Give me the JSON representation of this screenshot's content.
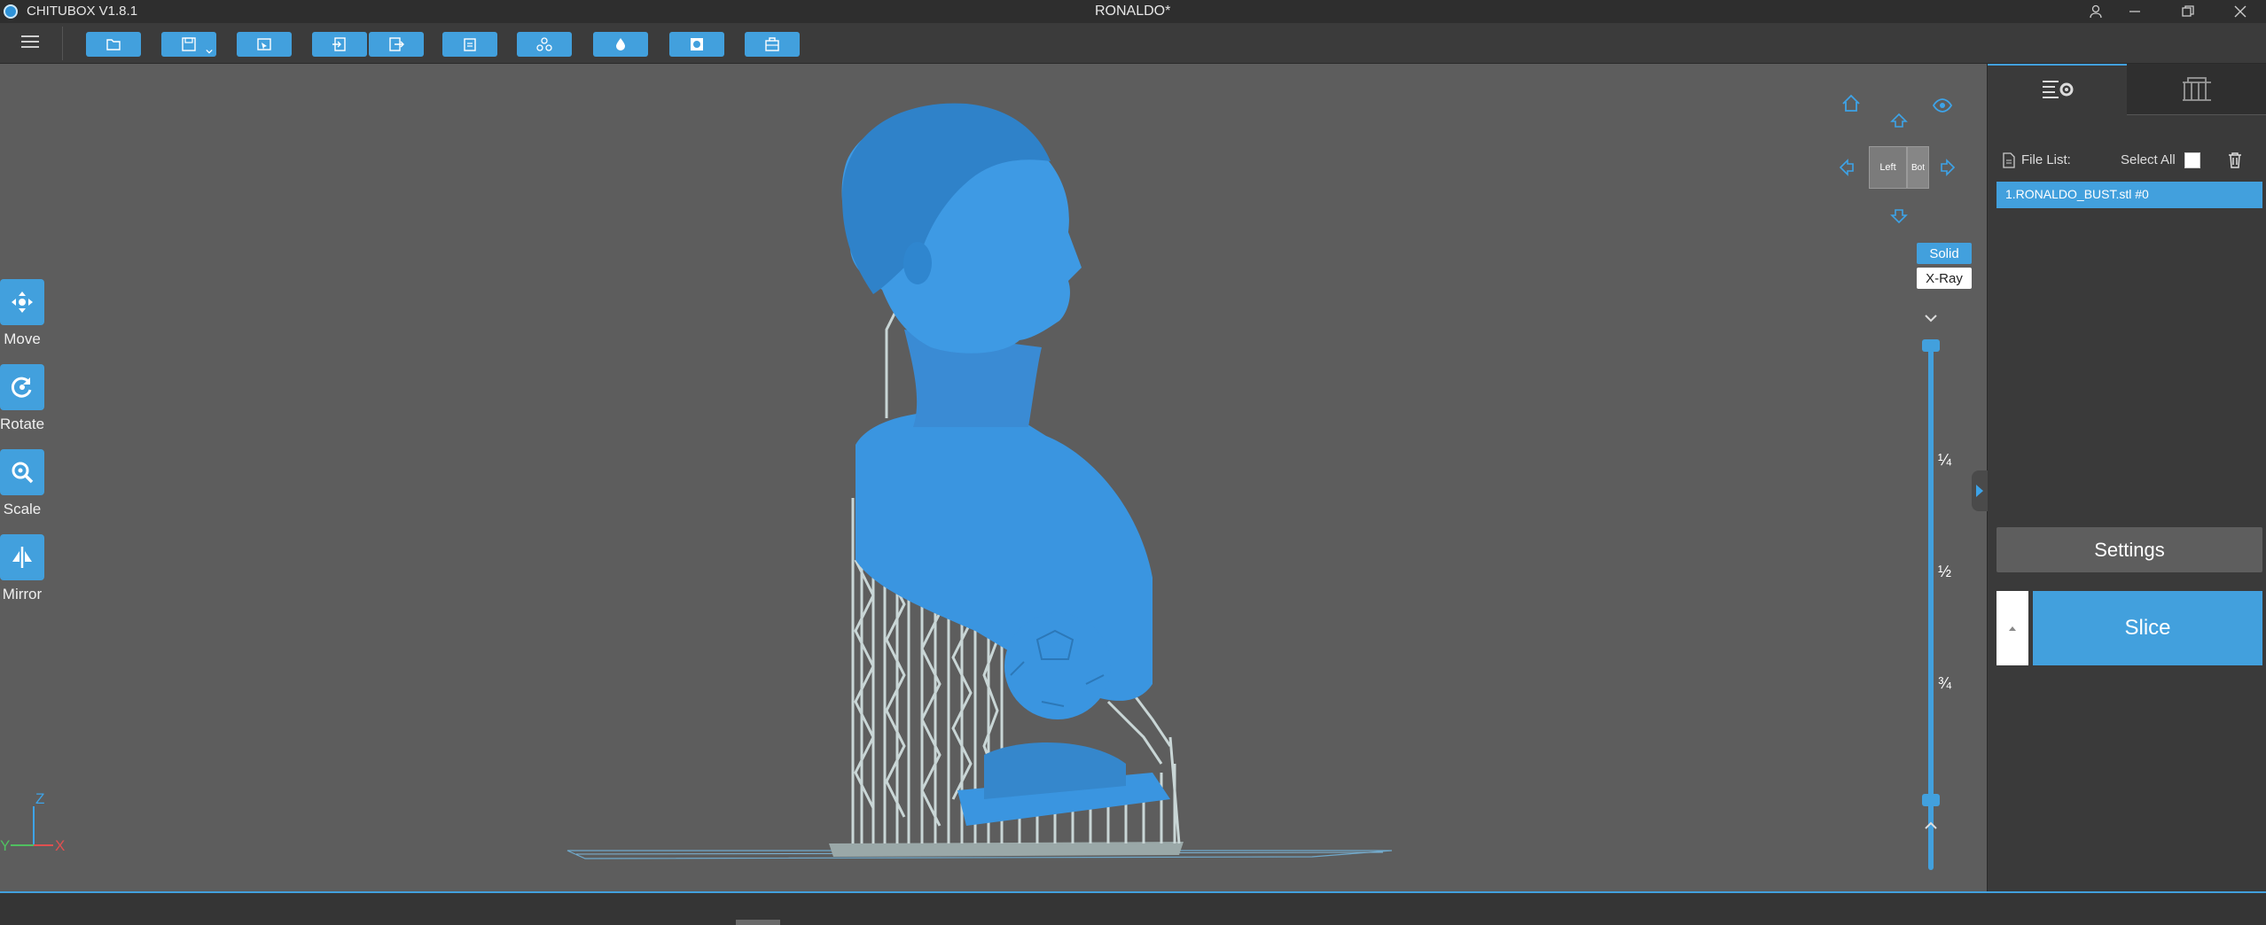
{
  "titlebar": {
    "app_name": "CHITUBOX V1.8.1",
    "document_title": "RONALDO*"
  },
  "toolbar": {
    "buttons": [
      {
        "name": "open-file-button",
        "icon": "folder-icon"
      },
      {
        "name": "save-button",
        "icon": "save-icon"
      },
      {
        "name": "select-button",
        "icon": "select-frame-icon"
      },
      {
        "name": "import-button",
        "icon": "import-icon"
      },
      {
        "name": "export-button",
        "icon": "export-icon"
      },
      {
        "name": "repair-button",
        "icon": "clipboard-icon"
      },
      {
        "name": "arrange-button",
        "icon": "arrange-icon"
      },
      {
        "name": "hollow-button",
        "icon": "drop-icon"
      },
      {
        "name": "dig-hole-button",
        "icon": "circle-hole-icon"
      },
      {
        "name": "supports-button",
        "icon": "package-icon"
      }
    ]
  },
  "tools": {
    "move": "Move",
    "rotate": "Rotate",
    "scale": "Scale",
    "mirror": "Mirror"
  },
  "navcube": {
    "left_face": "Left",
    "right_face": "Bot"
  },
  "view_modes": {
    "solid": "Solid",
    "xray": "X-Ray",
    "active": "Solid"
  },
  "layer_slider": {
    "tick_quarter": "¼",
    "tick_half": "½",
    "tick_three_quarter": "¾"
  },
  "axes": {
    "z": "Z",
    "y": "Y",
    "x": "X"
  },
  "panel": {
    "file_list_label": "File List:",
    "select_all_label": "Select All",
    "files": [
      "1.RONALDO_BUST.stl #0"
    ],
    "settings_label": "Settings",
    "slice_label": "Slice"
  },
  "colors": {
    "accent": "#42a0dd",
    "viewport_bg": "#5d5d5d",
    "model": "#3a95e0",
    "supports": "#b8c8c8"
  }
}
